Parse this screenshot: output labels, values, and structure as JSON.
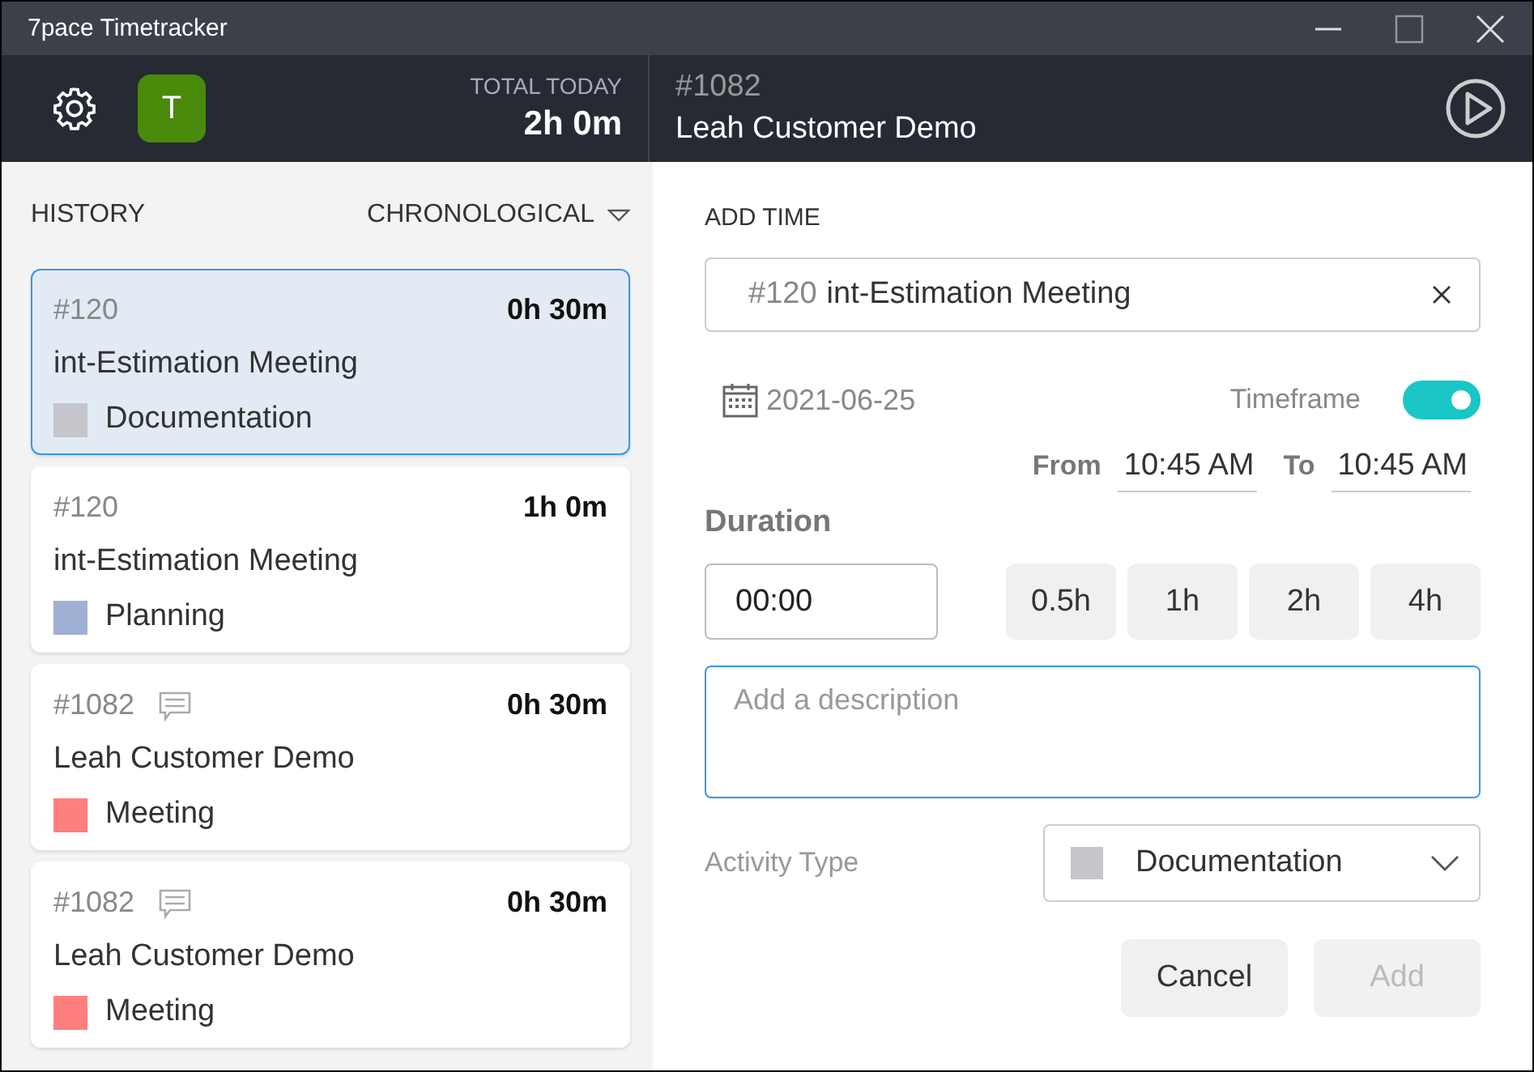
{
  "window": {
    "title": "7pace Timetracker"
  },
  "header": {
    "avatar_letter": "T",
    "total_label": "TOTAL TODAY",
    "total_value": "2h 0m",
    "current_id": "#1082",
    "current_title": "Leah Customer Demo"
  },
  "history": {
    "label": "HISTORY",
    "sort": "CHRONOLOGICAL",
    "entries": [
      {
        "id": "#120",
        "commented": false,
        "duration": "0h 30m",
        "title": "int-Estimation Meeting",
        "activity": "Documentation",
        "color": "#c4c6cc",
        "selected": true
      },
      {
        "id": "#120",
        "commented": false,
        "duration": "1h 0m",
        "title": "int-Estimation Meeting",
        "activity": "Planning",
        "color": "#a0afd4",
        "selected": false
      },
      {
        "id": "#1082",
        "commented": true,
        "duration": "0h 30m",
        "title": "Leah Customer Demo",
        "activity": "Meeting",
        "color": "#ff7f7f",
        "selected": false
      },
      {
        "id": "#1082",
        "commented": true,
        "duration": "0h 30m",
        "title": "Leah Customer Demo",
        "activity": "Meeting",
        "color": "#ff7f7f",
        "selected": false
      }
    ]
  },
  "form": {
    "label": "ADD TIME",
    "work_item_id": "#120",
    "work_item_title": "int-Estimation Meeting",
    "date": "2021-06-25",
    "timeframe_label": "Timeframe",
    "timeframe_on": true,
    "from_label": "From",
    "from_value": "10:45 AM",
    "to_label": "To",
    "to_value": "10:45 AM",
    "duration_label": "Duration",
    "duration_value": "00:00",
    "presets": [
      "0.5h",
      "1h",
      "2h",
      "4h"
    ],
    "description_placeholder": "Add a description",
    "activity_label": "Activity Type",
    "activity": {
      "value": "Documentation",
      "color": "#c4c6cc"
    },
    "buttons": [
      {
        "label": "Cancel",
        "disabled": false
      },
      {
        "label": "Add",
        "disabled": true
      }
    ]
  }
}
